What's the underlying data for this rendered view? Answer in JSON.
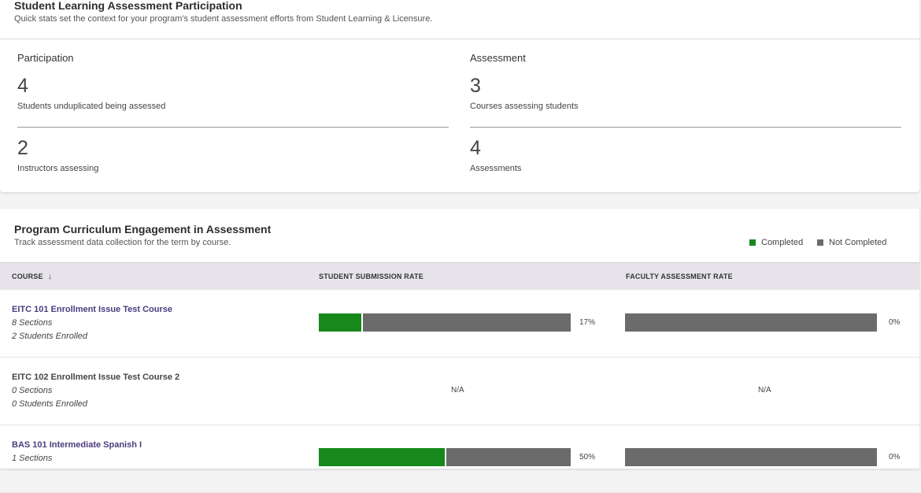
{
  "participation_card": {
    "title": "Student Learning Assessment Participation",
    "subtitle": "Quick stats set the context for your program's student assessment efforts from Student Learning & Licensure.",
    "participation": {
      "heading": "Participation",
      "stats": [
        {
          "value": "4",
          "label": "Students unduplicated being assessed"
        },
        {
          "value": "2",
          "label": "Instructors assessing"
        }
      ]
    },
    "assessment": {
      "heading": "Assessment",
      "stats": [
        {
          "value": "3",
          "label": "Courses assessing students"
        },
        {
          "value": "4",
          "label": "Assessments"
        }
      ]
    }
  },
  "engagement_card": {
    "title": "Program Curriculum Engagement in Assessment",
    "subtitle": "Track assessment data collection for the term by course.",
    "legend": [
      {
        "label": "Completed",
        "color": "#16881c"
      },
      {
        "label": "Not Completed",
        "color": "#6b6b6b"
      }
    ],
    "columns": {
      "course": "COURSE",
      "student_rate": "STUDENT SUBMISSION RATE",
      "faculty_rate": "FACULTY ASSESSMENT RATE"
    },
    "sort_icon": "arrow-down-icon",
    "rows": [
      {
        "name": "EITC 101 Enrollment Issue Test Course",
        "sections": "8 Sections",
        "enrolled": "2 Students Enrolled",
        "student_rate": 0.17,
        "student_label": "17%",
        "faculty_rate": 0,
        "faculty_label": "0%"
      },
      {
        "name": "EITC 102 Enrollment Issue Test Course 2",
        "sections": "0 Sections",
        "enrolled": "0 Students Enrolled",
        "student_label": "N/A",
        "faculty_label": "N/A"
      },
      {
        "name": "BAS 101 Intermediate Spanish I",
        "sections": "1 Sections",
        "student_rate": 0.5,
        "student_label": "50%",
        "faculty_rate": 0,
        "faculty_label": "0%"
      }
    ]
  }
}
